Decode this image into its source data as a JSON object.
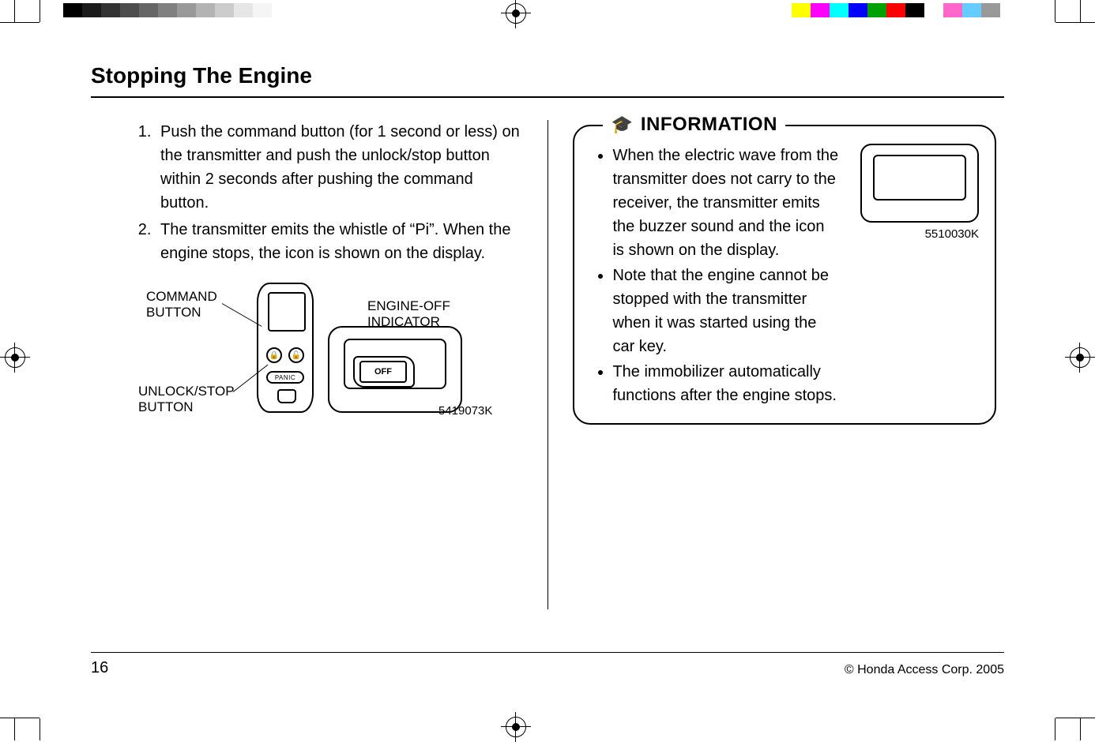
{
  "header": {
    "title": "Stopping The Engine"
  },
  "left": {
    "steps": [
      "Push the command button (for 1 second or less) on the transmitter and push the unlock/stop button within 2 seconds after pushing the command button.",
      "The transmitter emits the whistle of “Pi”.  When the engine stops, the icon is shown on the display."
    ],
    "figure": {
      "label_command_button": "COMMAND\nBUTTON",
      "label_unlock_stop_button": "UNLOCK/STOP\nBUTTON",
      "label_engine_off_indicator": "ENGINE-OFF\nINDICATOR",
      "panic_label": "PANIC",
      "off_label": "OFF",
      "image_code": "5419073K"
    }
  },
  "right": {
    "info_heading": "INFORMATION",
    "info_items": [
      "When the electric wave from the transmitter does not carry to the receiver, the transmitter emits the buzzer sound and the icon is shown on the display.",
      "Note that the engine cannot be stopped with the transmitter when it was started using the car key.",
      "The immobilizer automatically functions after the engine stops."
    ],
    "info_image_code": "5510030K"
  },
  "footer": {
    "page_number": "16",
    "copyright": "© Honda Access Corp. 2005"
  },
  "colorbars": {
    "left_gray": [
      "#000000",
      "#1a1a1a",
      "#333333",
      "#4d4d4d",
      "#666666",
      "#808080",
      "#999999",
      "#b3b3b3",
      "#cccccc",
      "#e6e6e6",
      "#f5f5f5",
      "#ffffff"
    ],
    "right_cmyk": [
      "#ffff00",
      "#ff00ff",
      "#00ffff",
      "#0000ff",
      "#00a000",
      "#ff0000",
      "#000000",
      "#ffffff",
      "#ff66cc",
      "#66ccff",
      "#999999"
    ]
  }
}
